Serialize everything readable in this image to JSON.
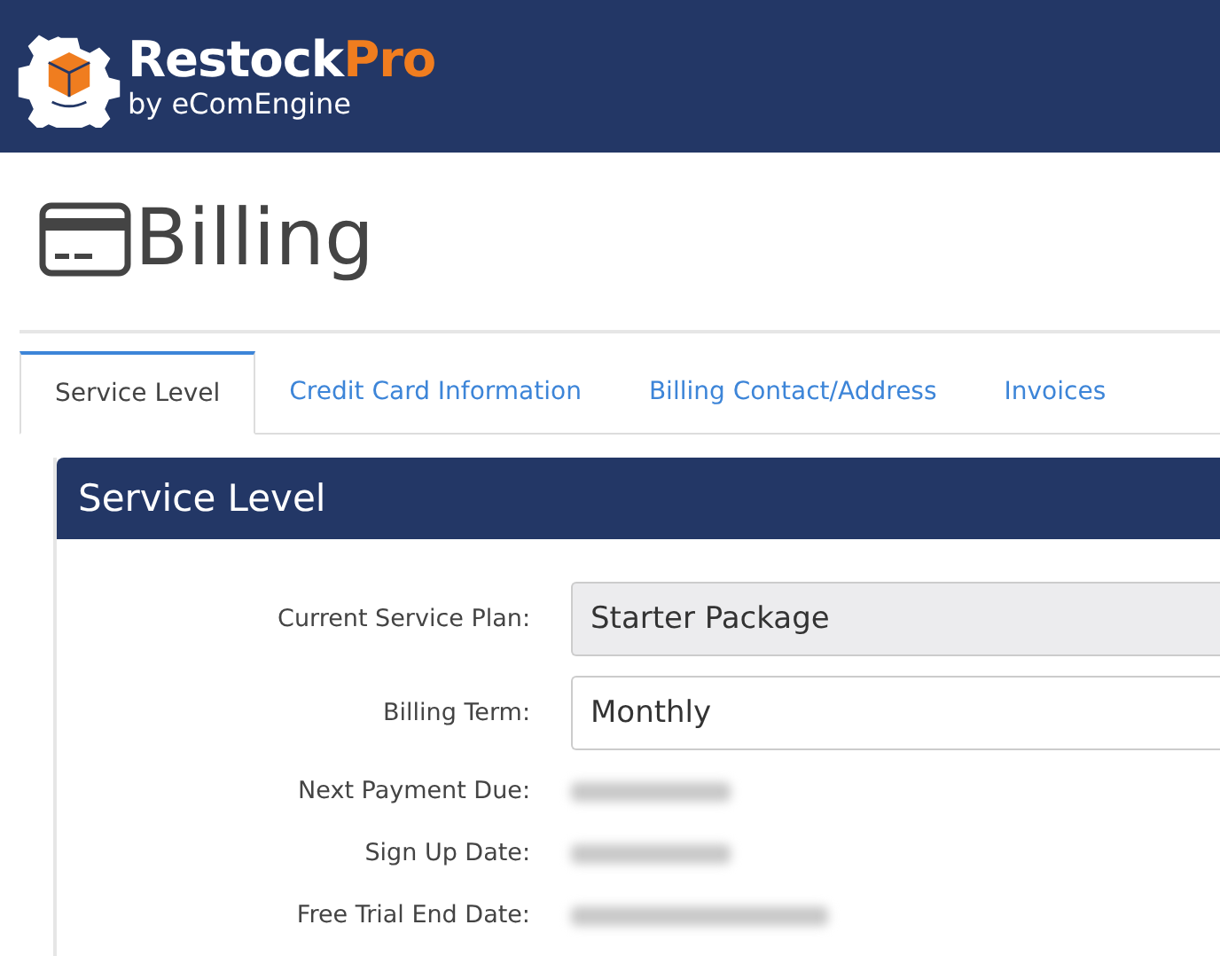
{
  "header": {
    "brand": "Restock",
    "brand_accent": "Pro",
    "byline": "by eComEngine"
  },
  "page": {
    "title": "Billing"
  },
  "tabs": [
    {
      "label": "Service Level",
      "selected": true
    },
    {
      "label": "Credit Card Information",
      "selected": false
    },
    {
      "label": "Billing Contact/Address",
      "selected": false
    },
    {
      "label": "Invoices",
      "selected": false
    }
  ],
  "panel": {
    "title": "Service Level",
    "fields": [
      {
        "label": "Current Service Plan:",
        "kind": "input",
        "value": "Starter Package",
        "disabled": true
      },
      {
        "label": "Billing Term:",
        "kind": "input",
        "value": "Monthly",
        "disabled": false
      },
      {
        "label": "Next Payment Due:",
        "kind": "redacted"
      },
      {
        "label": "Sign Up Date:",
        "kind": "redacted"
      },
      {
        "label": "Free Trial End Date:",
        "kind": "redacted_long"
      }
    ]
  }
}
